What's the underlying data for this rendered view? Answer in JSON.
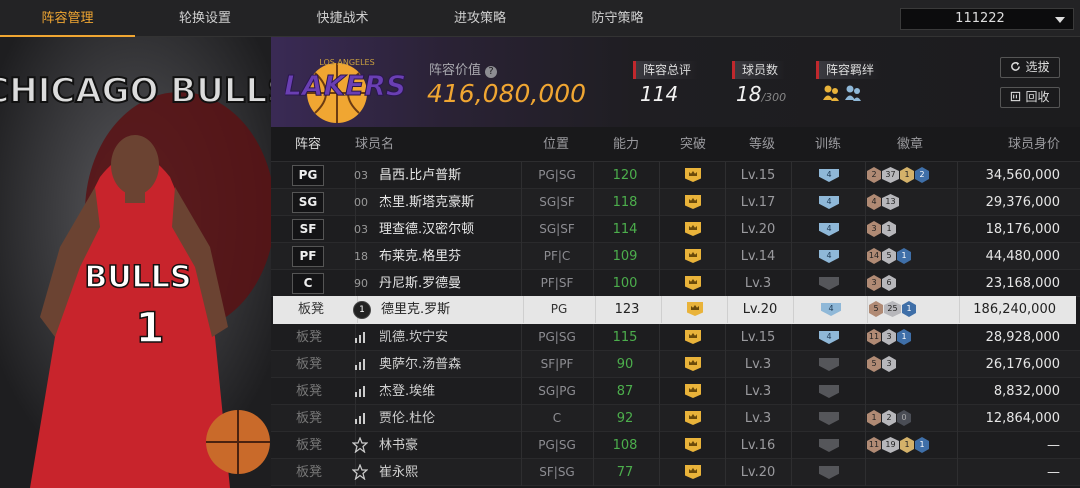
{
  "nav": {
    "tabs": [
      {
        "label": "阵容管理",
        "active": true
      },
      {
        "label": "轮换设置",
        "active": false
      },
      {
        "label": "快捷战术",
        "active": false
      },
      {
        "label": "进攻策略",
        "active": false
      },
      {
        "label": "防守策略",
        "active": false
      }
    ],
    "lineup_select": "111222"
  },
  "artwork": {
    "team_text": "CHICAGO BULLS",
    "jersey_text": "BULLS",
    "jersey_number": "1"
  },
  "header": {
    "logo_text": "LAKERS",
    "logo_subtext": "LOS ANGELES",
    "value_label": "阵容价值",
    "value_help_icon": "?",
    "value_amount": "416,080,000",
    "stats": [
      {
        "label": "阵容总评",
        "value": "114",
        "suffix": ""
      },
      {
        "label": "球员数",
        "value": "18",
        "suffix": "/300"
      },
      {
        "label": "阵容羁绊",
        "value": "",
        "suffix": ""
      }
    ],
    "buttons": {
      "select": "选拔",
      "recycle": "回收"
    }
  },
  "table": {
    "headers": [
      "阵容",
      "球员名",
      "位置",
      "能力",
      "突破",
      "等级",
      "训练",
      "徽章",
      "球员身价"
    ],
    "rows": [
      {
        "slot": "PG",
        "bench": false,
        "num": "03",
        "num_style": "plain",
        "name": "昌西.比卢普斯",
        "pos": "PG|SG",
        "power": "120",
        "level": "Lv.15",
        "train": "4",
        "train_on": true,
        "badges": [
          [
            "b",
            "2"
          ],
          [
            "w",
            "37"
          ],
          [
            "g",
            "1"
          ],
          [
            "p",
            "2"
          ]
        ],
        "value": "34,560,000"
      },
      {
        "slot": "SG",
        "bench": false,
        "num": "00",
        "num_style": "plain",
        "name": "杰里.斯塔克豪斯",
        "pos": "SG|SF",
        "power": "118",
        "level": "Lv.17",
        "train": "4",
        "train_on": true,
        "badges": [
          [
            "b",
            "4"
          ],
          [
            "w",
            "13"
          ]
        ],
        "value": "29,376,000"
      },
      {
        "slot": "SF",
        "bench": false,
        "num": "03",
        "num_style": "plain",
        "name": "理查德.汉密尔顿",
        "pos": "SG|SF",
        "power": "114",
        "level": "Lv.20",
        "train": "4",
        "train_on": true,
        "badges": [
          [
            "b",
            "3"
          ],
          [
            "s",
            "1"
          ]
        ],
        "value": "18,176,000"
      },
      {
        "slot": "PF",
        "bench": false,
        "num": "18",
        "num_style": "plain",
        "name": "布莱克.格里芬",
        "pos": "PF|C",
        "power": "109",
        "level": "Lv.14",
        "train": "4",
        "train_on": true,
        "badges": [
          [
            "b",
            "14"
          ],
          [
            "s",
            "5"
          ],
          [
            "p",
            "1"
          ]
        ],
        "value": "44,480,000"
      },
      {
        "slot": "C",
        "bench": false,
        "num": "90",
        "num_style": "plain",
        "name": "丹尼斯.罗德曼",
        "pos": "PF|SF",
        "power": "100",
        "level": "Lv.3",
        "train": "",
        "train_on": false,
        "badges": [
          [
            "b",
            "3"
          ],
          [
            "s",
            "6"
          ]
        ],
        "value": "23,168,000"
      },
      {
        "slot": "板凳",
        "bench": true,
        "selected": true,
        "num": "1",
        "num_style": "circle",
        "name": "德里克.罗斯",
        "pos": "PG",
        "power": "123",
        "level": "Lv.20",
        "train": "4",
        "train_on": true,
        "badges": [
          [
            "b",
            "5"
          ],
          [
            "w",
            "25"
          ],
          [
            "p",
            "1"
          ]
        ],
        "value": "186,240,000"
      },
      {
        "slot": "板凳",
        "bench": true,
        "num": "",
        "num_style": "bars",
        "name": "凯德.坎宁安",
        "pos": "PG|SG",
        "power": "115",
        "level": "Lv.15",
        "train": "4",
        "train_on": true,
        "badges": [
          [
            "b",
            "11"
          ],
          [
            "s",
            "3"
          ],
          [
            "p",
            "1"
          ]
        ],
        "value": "28,928,000"
      },
      {
        "slot": "板凳",
        "bench": true,
        "num": "",
        "num_style": "bars",
        "name": "奥萨尔.汤普森",
        "pos": "SF|PF",
        "power": "90",
        "level": "Lv.3",
        "train": "",
        "train_on": false,
        "badges": [
          [
            "b",
            "5"
          ],
          [
            "s",
            "3"
          ]
        ],
        "value": "26,176,000"
      },
      {
        "slot": "板凳",
        "bench": true,
        "num": "",
        "num_style": "bars",
        "name": "杰登.埃维",
        "pos": "SG|PG",
        "power": "87",
        "level": "Lv.3",
        "train": "",
        "train_on": false,
        "badges": [],
        "value": "8,832,000"
      },
      {
        "slot": "板凳",
        "bench": true,
        "num": "",
        "num_style": "bars",
        "name": "贾伦.杜伦",
        "pos": "C",
        "power": "92",
        "level": "Lv.3",
        "train": "",
        "train_on": false,
        "badges": [
          [
            "b",
            "1"
          ],
          [
            "s",
            "2"
          ],
          [
            "e",
            "0"
          ]
        ],
        "value": "12,864,000"
      },
      {
        "slot": "板凳",
        "bench": true,
        "num": "",
        "num_style": "star",
        "name": "林书豪",
        "pos": "PG|SG",
        "power": "108",
        "level": "Lv.16",
        "train": "",
        "train_on": false,
        "badges": [
          [
            "b",
            "11"
          ],
          [
            "w",
            "19"
          ],
          [
            "g",
            "1"
          ],
          [
            "p",
            "1"
          ]
        ],
        "value": "—"
      },
      {
        "slot": "板凳",
        "bench": true,
        "num": "",
        "num_style": "star",
        "name": "崔永熙",
        "pos": "SF|SG",
        "power": "77",
        "level": "Lv.20",
        "train": "",
        "train_on": false,
        "badges": [],
        "value": "—"
      }
    ]
  },
  "colors": {
    "accent": "#f0a632",
    "power": "#4cae4c",
    "stat_marker": "#c0282d",
    "selected_row": "#e6e6e6"
  }
}
